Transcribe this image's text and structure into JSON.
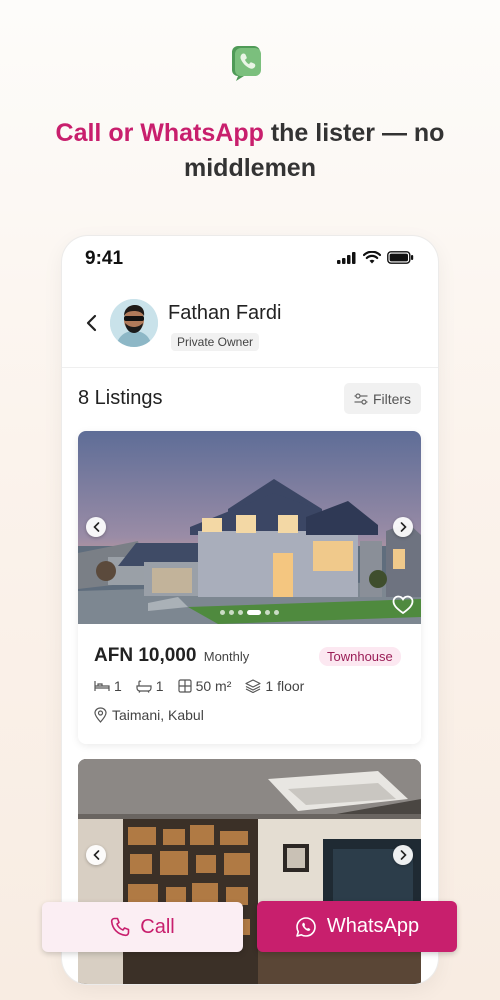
{
  "headline": {
    "highlight": "Call or WhatsApp",
    "rest": " the lister — no middlemen"
  },
  "status_bar": {
    "time": "9:41",
    "icons": [
      "signal-icon",
      "wifi-icon",
      "battery-icon"
    ]
  },
  "profile": {
    "name": "Fathan Fardi",
    "badge": "Private Owner"
  },
  "listings": {
    "count_label": "8 Listings",
    "filters_label": "Filters"
  },
  "cards": [
    {
      "price": "AFN 10,000",
      "period": "Monthly",
      "type": "Townhouse",
      "beds": "1",
      "baths": "1",
      "area": "50 m²",
      "floor": "1 floor",
      "location": "Taimani, Kabul",
      "photo_dots": 6,
      "active_dot": 3
    }
  ],
  "actions": {
    "call_label": "Call",
    "whatsapp_label": "WhatsApp"
  },
  "colors": {
    "brand": "#c81f6d",
    "brand_light": "#fbeef3",
    "app_icon": "#5aa35f"
  }
}
